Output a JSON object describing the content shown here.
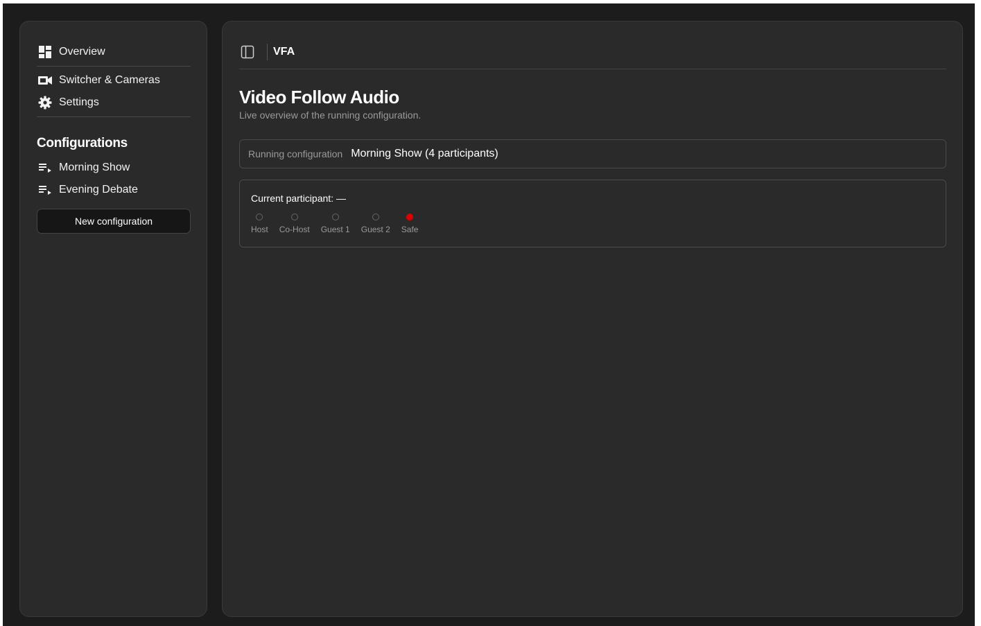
{
  "sidebar": {
    "nav": [
      {
        "label": "Overview",
        "icon": "dashboard-icon"
      },
      {
        "label": "Switcher & Cameras",
        "icon": "video-camera-icon"
      },
      {
        "label": "Settings",
        "icon": "gear-icon"
      }
    ],
    "section_title": "Configurations",
    "configurations": [
      {
        "label": "Morning Show",
        "icon": "playlist-play-icon"
      },
      {
        "label": "Evening Debate",
        "icon": "playlist-play-icon"
      }
    ],
    "new_config_label": "New configuration"
  },
  "header": {
    "toggle_icon": "sidebar-toggle-icon",
    "breadcrumb": "VFA"
  },
  "page": {
    "title": "Video Follow Audio",
    "subtitle": "Live overview of the running configuration."
  },
  "running": {
    "label": "Running configuration",
    "value": "Morning Show (4 participants)"
  },
  "current": {
    "label": "Current participant: —",
    "participants": [
      {
        "label": "Host",
        "active": false
      },
      {
        "label": "Co-Host",
        "active": false
      },
      {
        "label": "Guest 1",
        "active": false
      },
      {
        "label": "Guest 2",
        "active": false
      },
      {
        "label": "Safe",
        "active": true
      }
    ]
  },
  "colors": {
    "background": "#1c1c1c",
    "panel": "#2a2a2a",
    "active_indicator": "#e00000"
  }
}
